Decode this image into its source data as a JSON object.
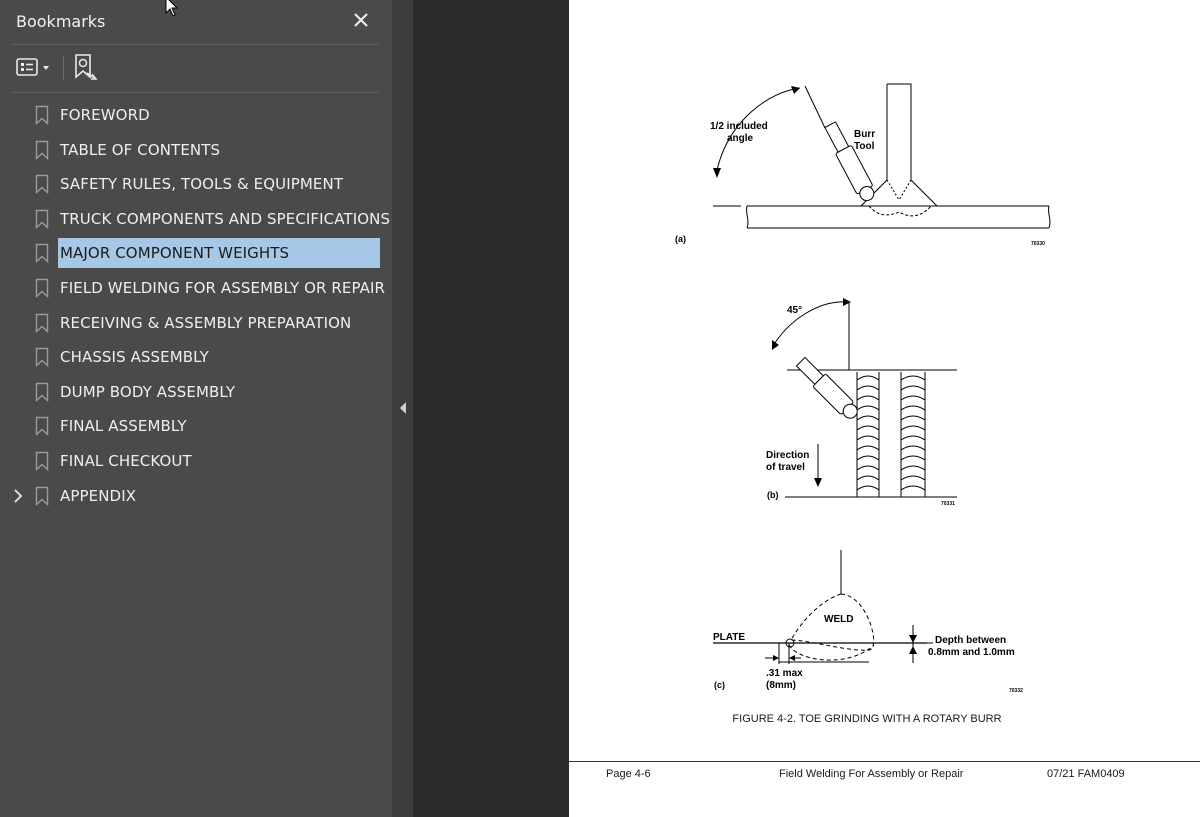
{
  "bookmarks_panel": {
    "title": "Bookmarks",
    "items": [
      {
        "label": "FOREWORD",
        "selected": false,
        "expandable": false
      },
      {
        "label": "TABLE OF CONTENTS",
        "selected": false,
        "expandable": false
      },
      {
        "label": "SAFETY RULES, TOOLS & EQUIPMENT",
        "selected": false,
        "expandable": false
      },
      {
        "label": "TRUCK COMPONENTS AND SPECIFICATIONS",
        "selected": false,
        "expandable": false
      },
      {
        "label": "MAJOR COMPONENT WEIGHTS",
        "selected": true,
        "expandable": false
      },
      {
        "label": "FIELD WELDING FOR ASSEMBLY OR REPAIR",
        "selected": false,
        "expandable": false
      },
      {
        "label": "RECEIVING & ASSEMBLY PREPARATION",
        "selected": false,
        "expandable": false
      },
      {
        "label": "CHASSIS ASSEMBLY",
        "selected": false,
        "expandable": false
      },
      {
        "label": "DUMP BODY ASSEMBLY",
        "selected": false,
        "expandable": false
      },
      {
        "label": "FINAL ASSEMBLY",
        "selected": false,
        "expandable": false
      },
      {
        "label": "FINAL CHECKOUT",
        "selected": false,
        "expandable": false
      },
      {
        "label": "APPENDIX",
        "selected": false,
        "expandable": true
      }
    ]
  },
  "figure": {
    "a": {
      "label": "(a)",
      "angle_label_1": "1/2 included",
      "angle_label_2": "angle",
      "tool_label_1": "Burr",
      "tool_label_2": "Tool",
      "code": "70330"
    },
    "b": {
      "label": "(b)",
      "angle": "45°",
      "direction_1": "Direction",
      "direction_2": "of travel",
      "code": "70331"
    },
    "c": {
      "label": "(c)",
      "weld": "WELD",
      "plate": "PLATE",
      "depth_1": "Depth between",
      "depth_2": "0.8mm and 1.0mm",
      "max_1": ".31 max",
      "max_2": "(8mm)",
      "code": "70332"
    },
    "caption": "FIGURE 4-2. TOE GRINDING WITH A ROTARY BURR"
  },
  "footer": {
    "page": "Page 4-6",
    "section": "Field Welding For Assembly or Repair",
    "doc": "07/21  FAM0409"
  },
  "colors": {
    "panel_bg": "#4a4a4a",
    "selection_bg": "#a6c8e6",
    "viewer_bg": "#2a2a2a"
  }
}
